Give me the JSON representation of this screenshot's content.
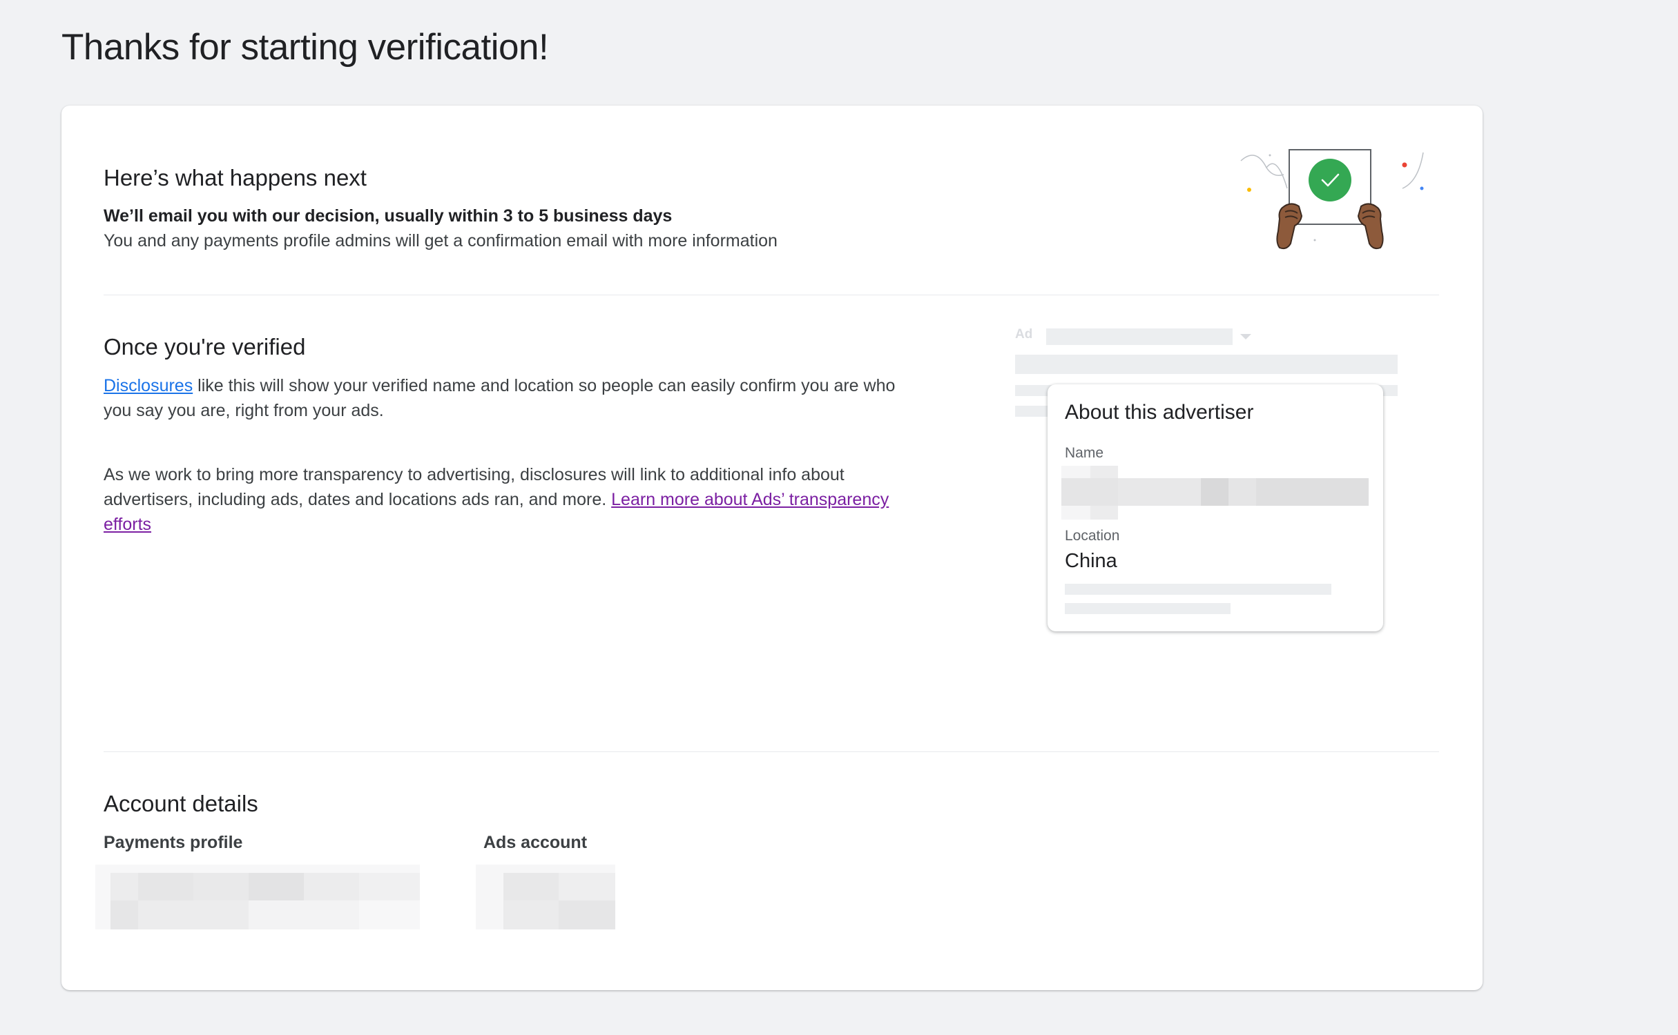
{
  "page": {
    "title": "Thanks for starting verification!"
  },
  "next_steps": {
    "heading": "Here’s what happens next",
    "bold_line": "We’ll email you with our decision, usually within 3 to 5 business days",
    "detail_line": "You and any payments profile admins will get a confirmation email with more information"
  },
  "verified": {
    "heading": "Once you're verified",
    "disclosures_link": "Disclosures",
    "disclosures_text": " like this will show your verified name and location so people can easily confirm you are who you say you are, right from your ads.",
    "transparency_text": "As we work to bring more transparency to advertising, disclosures will link to additional info about advertisers, including ads, dates and locations ads ran, and more. ",
    "transparency_link": "Learn more about Ads’ transparency efforts"
  },
  "ad_preview": {
    "ad_label": "Ad",
    "card_title": "About this advertiser",
    "name_label": "Name",
    "location_label": "Location",
    "location_value": "China"
  },
  "account": {
    "heading": "Account details",
    "payments_profile_label": "Payments profile",
    "ads_account_label": "Ads account"
  },
  "colors": {
    "accent_green": "#34a853",
    "link_blue": "#1a73e8",
    "link_visited_purple": "#7b1fa2"
  }
}
